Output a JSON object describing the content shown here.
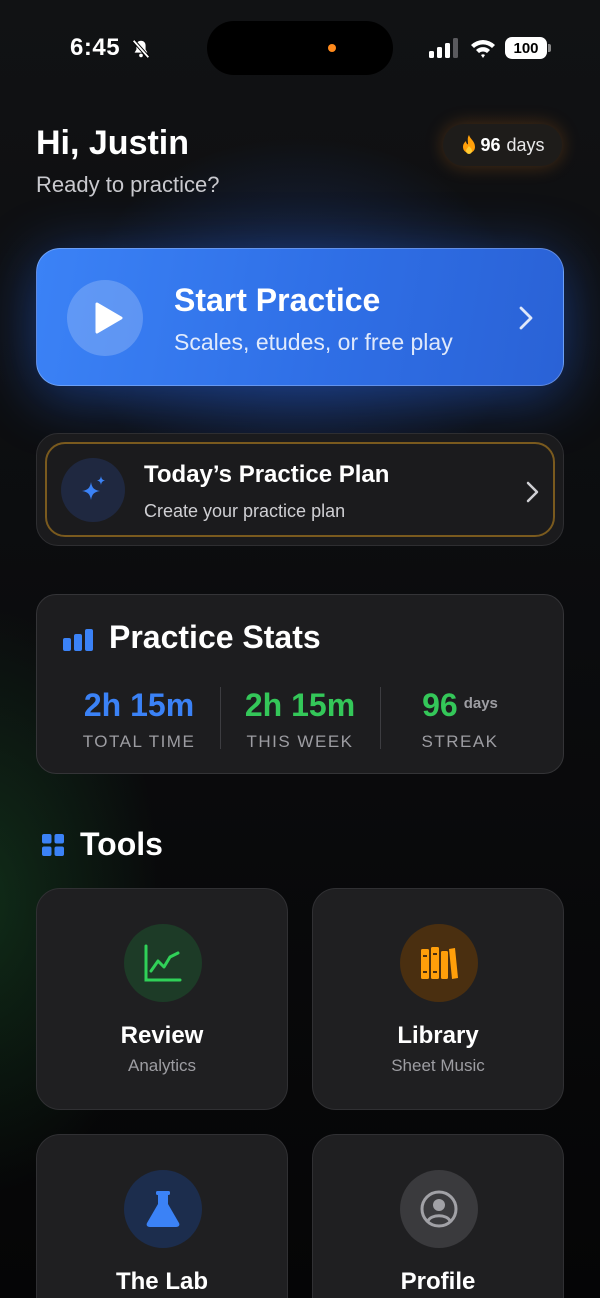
{
  "status_bar": {
    "time": "6:45",
    "battery": "100"
  },
  "header": {
    "greeting": "Hi, Justin",
    "subtitle": "Ready to practice?",
    "streak_value": "96",
    "streak_unit": "days"
  },
  "start_practice": {
    "title": "Start Practice",
    "subtitle": "Scales, etudes, or free play"
  },
  "plan": {
    "title": "Today’s Practice Plan",
    "subtitle": "Create your practice plan"
  },
  "stats": {
    "title": "Practice Stats",
    "items": [
      {
        "value": "2h 15m",
        "label": "TOTAL TIME",
        "color": "#3b82f6"
      },
      {
        "value": "2h 15m",
        "label": "THIS WEEK",
        "color": "#34c759"
      },
      {
        "value": "96",
        "unit": "days",
        "label": "STREAK",
        "color": "#34c759"
      }
    ]
  },
  "tools": {
    "title": "Tools",
    "items": [
      {
        "title": "Review",
        "subtitle": "Analytics",
        "icon": "chart-line-icon",
        "color": "#30d158"
      },
      {
        "title": "Library",
        "subtitle": "Sheet Music",
        "icon": "books-icon",
        "color": "#ff9f0a"
      },
      {
        "title": "The Lab",
        "subtitle": "",
        "icon": "flask-icon",
        "color": "#3b82f6"
      },
      {
        "title": "Profile",
        "subtitle": "",
        "icon": "person-circle-icon",
        "color": "#8e8e93"
      }
    ]
  }
}
